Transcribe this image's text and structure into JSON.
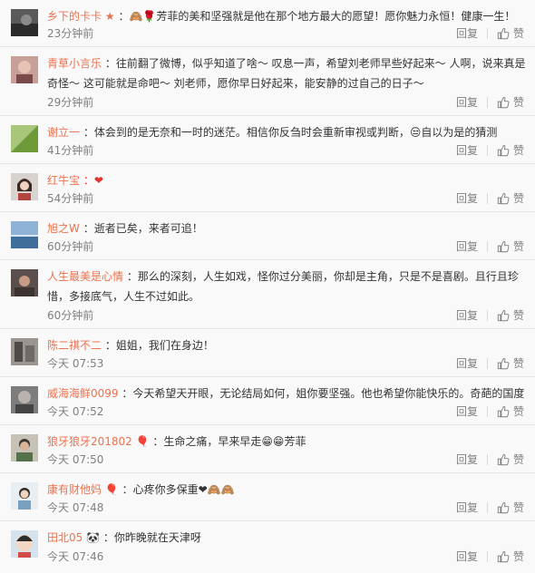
{
  "actions": {
    "reply_label": "回复",
    "like_label": "赞"
  },
  "comments": [
    {
      "user": "乡下的卡卡",
      "text": "：🙈🌹芳菲的美和坚强就是他在那个地方最大的愿望！愿你魅力永恒！健康一生！",
      "time": "23分钟前",
      "badge": "★"
    },
    {
      "user": "青草小言乐",
      "text": "：往前翻了微博，似乎知道了啥～ 叹息一声，希望刘老师早些好起来～ 人啊，说来真是奇怪～ 这可能就是命吧～ 刘老师，愿你早日好起来，能安静的过自己的日子～",
      "time": "29分钟前"
    },
    {
      "user": "谢立一",
      "text": "：体会到的是无奈和一时的迷茫。相信你反刍时会重新审视或判断，😒自以为是的猜测",
      "time": "41分钟前"
    },
    {
      "user": "红牛宝",
      "text": "：❤",
      "time": "54分钟前"
    },
    {
      "user": "旭之W",
      "text": "：逝者已矣，来者可追！",
      "time": "60分钟前"
    },
    {
      "user": "人生最美是心情",
      "text": "：那么的深刻，人生如戏，怪你过分美丽，你却是主角，只是不是喜剧。且行且珍惜，多接底气，人生不过如此。",
      "time": "60分钟前"
    },
    {
      "user": "陈二祺不二",
      "text": "：姐姐，我们在身边！",
      "time": "今天 07:53"
    },
    {
      "user": "威海海鲜0099",
      "text": "：今天希望天开眼，无论结局如何，姐你要坚强。他也希望你能快乐的。奇葩的国度",
      "time": "今天 07:52"
    },
    {
      "user": "狼牙狼牙201802",
      "text": "：生命之痛，早来早走😁😁芳菲",
      "time": "今天 07:50",
      "badge": "🎈"
    },
    {
      "user": "康有财他妈",
      "text": "：心疼你多保重❤🙈🙈",
      "time": "今天 07:48",
      "badge": "🎈"
    },
    {
      "user": "田北05",
      "text": "：你昨晚就在天津呀",
      "time": "今天 07:46",
      "badge": "🐼"
    }
  ],
  "colors": {
    "username": "#eb7350",
    "meta": "#808080",
    "divider": "#e6e6e6",
    "background": "#f9f9f9"
  },
  "icons": {
    "like": "thumbs-up-icon",
    "avatar": "user-avatar-image"
  }
}
